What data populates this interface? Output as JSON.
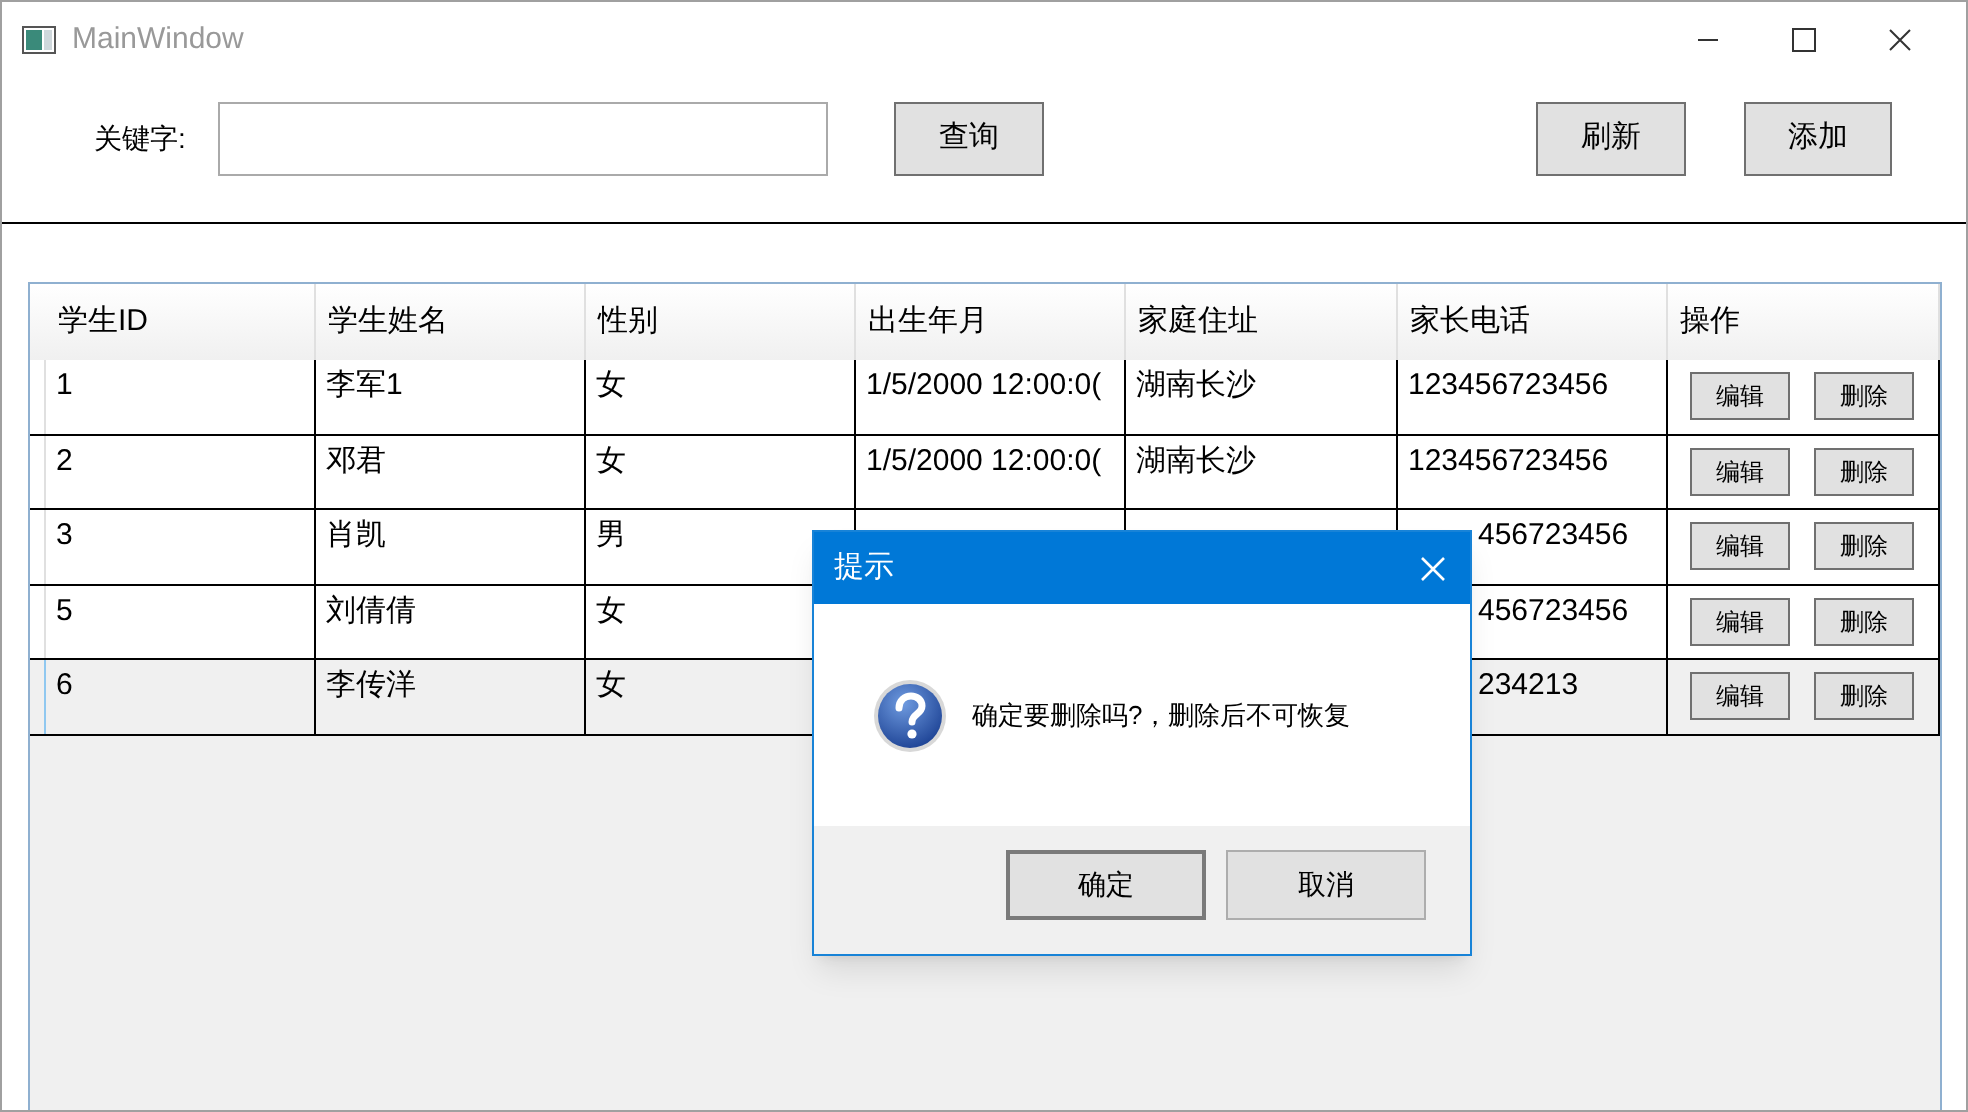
{
  "window": {
    "title": "MainWindow"
  },
  "toolbar": {
    "keyword_label": "关键字:",
    "search_button": "查询",
    "refresh_button": "刷新",
    "add_button": "添加"
  },
  "table": {
    "columns": [
      "学生ID",
      "学生姓名",
      "性别",
      "出生年月",
      "家庭住址",
      "家长电话",
      "操作"
    ],
    "rows": [
      {
        "selected": false,
        "covered": false,
        "cells": [
          "1",
          "李军1",
          "女",
          "1/5/2000 12:00:0(",
          "湖南长沙",
          "123456723456"
        ],
        "actions": [
          "编辑",
          "删除"
        ]
      },
      {
        "selected": false,
        "covered": false,
        "cells": [
          "2",
          "邓君",
          "女",
          "1/5/2000 12:00:0(",
          "湖南长沙",
          "123456723456"
        ],
        "actions": [
          "编辑",
          "删除"
        ]
      },
      {
        "selected": false,
        "covered": true,
        "cells": [
          "3",
          "肖凯",
          "男",
          "",
          "",
          "456723456"
        ],
        "actions": [
          "编辑",
          "删除"
        ]
      },
      {
        "selected": false,
        "covered": true,
        "cells": [
          "5",
          "刘倩倩",
          "女",
          "",
          "",
          "456723456"
        ],
        "actions": [
          "编辑",
          "删除"
        ]
      },
      {
        "selected": true,
        "covered": true,
        "cells": [
          "6",
          "李传洋",
          "女",
          "",
          "",
          "234213"
        ],
        "actions": [
          "编辑",
          "删除"
        ]
      }
    ]
  },
  "dialog": {
    "title": "提示",
    "message": "确定要删除吗?，删除后不可恢复",
    "buttons": [
      "确定",
      "取消"
    ]
  }
}
